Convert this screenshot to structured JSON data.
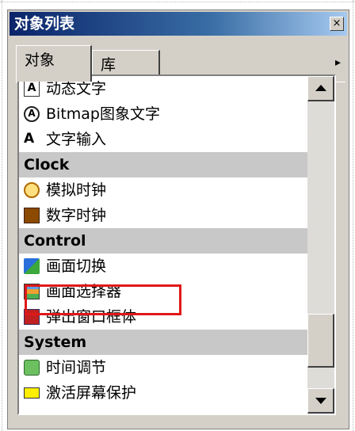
{
  "window": {
    "title": "对象列表",
    "close_label": "×"
  },
  "tabs": [
    {
      "label": "对象",
      "active": true
    },
    {
      "label": "库",
      "active": false
    }
  ],
  "tab_scroll_arrow": "▸",
  "list": {
    "rows": [
      {
        "type": "item",
        "label": "动态文字",
        "icon": "text-a-icon",
        "icon_glyph": "A"
      },
      {
        "type": "item",
        "label": "Bitmap图象文字",
        "icon": "bitmap-text-icon",
        "icon_glyph": "A"
      },
      {
        "type": "item",
        "label": "文字输入",
        "icon": "text-input-icon",
        "icon_glyph": "A"
      },
      {
        "type": "category",
        "label": "Clock"
      },
      {
        "type": "item",
        "label": "模拟时钟",
        "icon": "analog-clock-icon"
      },
      {
        "type": "item",
        "label": "数字时钟",
        "icon": "digital-clock-icon"
      },
      {
        "type": "category",
        "label": "Control"
      },
      {
        "type": "item",
        "label": "画面切换",
        "icon": "screen-switch-icon"
      },
      {
        "type": "item",
        "label": "画面选择器",
        "icon": "screen-selector-icon",
        "highlighted": true
      },
      {
        "type": "item",
        "label": "弹出窗口框体",
        "icon": "popup-window-icon"
      },
      {
        "type": "category",
        "label": "System"
      },
      {
        "type": "item",
        "label": "时间调节",
        "icon": "time-adjust-icon"
      },
      {
        "type": "item",
        "label": "激活屏幕保护",
        "icon": "screensaver-icon"
      }
    ]
  },
  "colors": {
    "titlebar_start": "#0a246a",
    "titlebar_end": "#a6caf0",
    "panel": "#d4d0c8",
    "category_bg": "#c8c8c8",
    "highlight_border": "#e01818"
  }
}
